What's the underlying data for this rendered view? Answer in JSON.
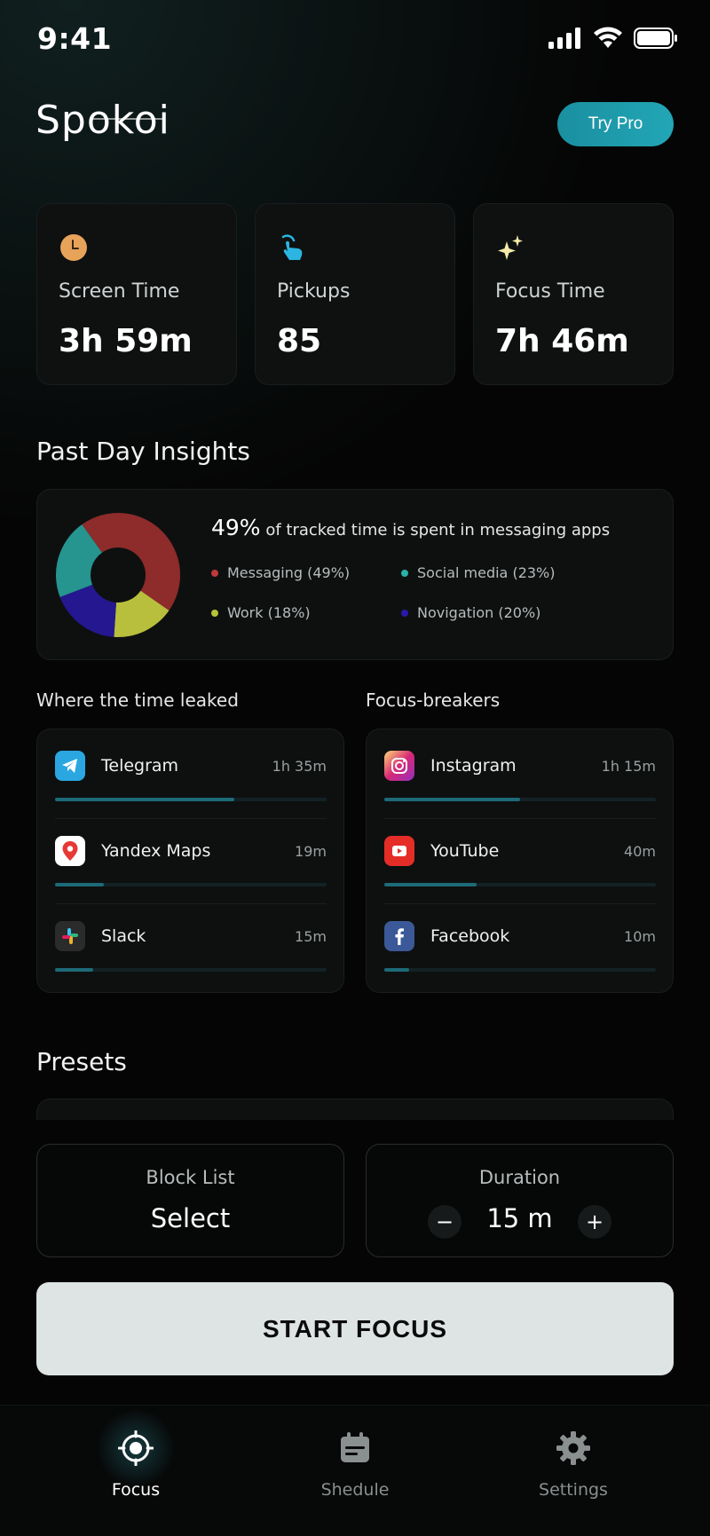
{
  "status_bar": {
    "time": "9:41"
  },
  "header": {
    "logo": "Spokoi",
    "try_pro_label": "Try Pro"
  },
  "stats": [
    {
      "label": "Screen Time",
      "value": "3h 59m",
      "icon": "clock-icon"
    },
    {
      "label": "Pickups",
      "value": "85",
      "icon": "tap-hand-icon"
    },
    {
      "label": "Focus Time",
      "value": "7h 46m",
      "icon": "sparkles-icon"
    }
  ],
  "insights": {
    "title": "Past Day Insights",
    "headline_pct": "49%",
    "headline_text": "of tracked time is spent in messaging apps",
    "legend": [
      {
        "label": "Messaging (49%)",
        "color": "#c0393b"
      },
      {
        "label": "Social media (23%)",
        "color": "#2ab0a8"
      },
      {
        "label": "Work (18%)",
        "color": "#b5c23a"
      },
      {
        "label": "Novigation (20%)",
        "color": "#2a1aa8"
      }
    ]
  },
  "chart_data": {
    "type": "pie",
    "categories": [
      "Messaging",
      "Work",
      "Novigation",
      "Social media"
    ],
    "values": [
      49,
      18,
      20,
      23
    ],
    "colors": [
      "#8e2b2b",
      "#b8bf3c",
      "#25178f",
      "#26948f"
    ]
  },
  "time_leaked": {
    "title": "Where the time leaked",
    "items": [
      {
        "name": "Telegram",
        "time": "1h 35m",
        "fraction": 0.66,
        "icon": "telegram-icon"
      },
      {
        "name": "Yandex Maps",
        "time": "19m",
        "fraction": 0.18,
        "icon": "map-pin-icon"
      },
      {
        "name": "Slack",
        "time": "15m",
        "fraction": 0.14,
        "icon": "slack-icon"
      }
    ]
  },
  "focus_breakers": {
    "title": "Focus-breakers",
    "items": [
      {
        "name": "Instagram",
        "time": "1h 15m",
        "fraction": 0.5,
        "icon": "instagram-icon"
      },
      {
        "name": "YouTube",
        "time": "40m",
        "fraction": 0.34,
        "icon": "youtube-icon"
      },
      {
        "name": "Facebook",
        "time": "10m",
        "fraction": 0.09,
        "icon": "facebook-icon"
      }
    ]
  },
  "presets": {
    "title": "Presets"
  },
  "block_list": {
    "label": "Block List",
    "value": "Select"
  },
  "duration": {
    "label": "Duration",
    "value": "15 m",
    "minus": "−",
    "plus": "+"
  },
  "start_button": {
    "label": "START FOCUS"
  },
  "nav": [
    {
      "label": "Focus",
      "icon": "target-icon",
      "active": true
    },
    {
      "label": "Shedule",
      "icon": "calendar-icon",
      "active": false
    },
    {
      "label": "Settings",
      "icon": "gear-icon",
      "active": false
    }
  ]
}
